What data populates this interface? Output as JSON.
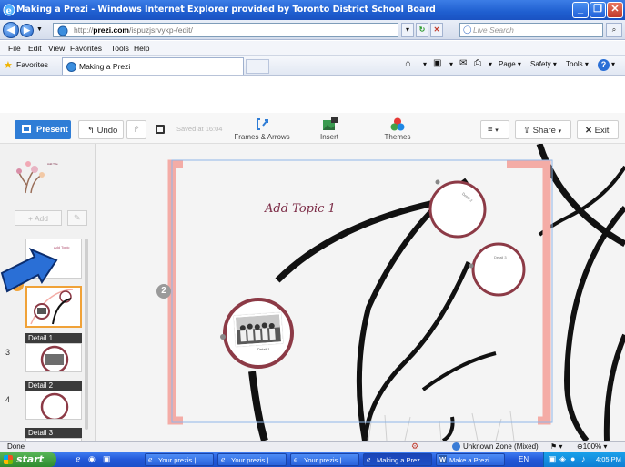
{
  "window": {
    "title": "Making a Prezi - Windows Internet Explorer provided by Toronto District School Board"
  },
  "addressbar": {
    "url_prefix": "http://",
    "url_domain": "prezi.com",
    "url_path": "/ispuzjsrvykp-/edit/",
    "search_placeholder": "Live Search"
  },
  "menu": [
    "File",
    "Edit",
    "View",
    "Favorites",
    "Tools",
    "Help"
  ],
  "favorites": {
    "label": "Favorites",
    "tab_title": "Making a Prezi",
    "tools": [
      "Page",
      "Safety",
      "Tools"
    ]
  },
  "prezi_toolbar": {
    "present": "Present",
    "undo": "Undo",
    "saved": "Saved at 16:04",
    "frames": "Frames & Arrows",
    "insert": "Insert",
    "themes": "Themes",
    "share": "Share",
    "exit": "Exit"
  },
  "sidebar": {
    "add": "+ Add",
    "current_step": "2",
    "steps": [
      {
        "num": "3",
        "label": "Detail 1"
      },
      {
        "num": "4",
        "label": "Detail 2"
      },
      {
        "label": "Detail 3"
      }
    ]
  },
  "canvas": {
    "frame_number": "2",
    "topic_title": "Add Topic 1",
    "photo_caption": "Detail 1",
    "bubble_a": "Detail 2",
    "bubble_b": "Detail 3"
  },
  "status": {
    "left": "Done",
    "zone": "Unknown Zone (Mixed)",
    "zoom": "100%"
  },
  "taskbar": {
    "start": "start",
    "tasks": [
      "Your prezis | ...",
      "Your prezis | ...",
      "Your prezis | ...",
      "Making a Prez...",
      "Make a Prezi...."
    ],
    "lang": "EN",
    "clock": "4:05 PM"
  },
  "colors": {
    "accent": "#2f7dd6",
    "frame_bracket": "#f4aca6",
    "circle": "#8c3a46",
    "topic_title": "#7b2a45"
  }
}
